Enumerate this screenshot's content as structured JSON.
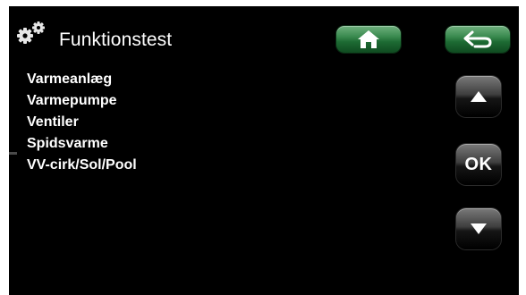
{
  "header": {
    "icon": "gears-icon",
    "title": "Funktionstest",
    "home_icon": "home-icon",
    "back_icon": "back-arrow-icon"
  },
  "menu": {
    "items": [
      {
        "label": "Varmeanlæg"
      },
      {
        "label": "Varmepumpe"
      },
      {
        "label": "Ventiler"
      },
      {
        "label": "Spidsvarme"
      },
      {
        "label": "VV-cirk/Sol/Pool"
      }
    ]
  },
  "nav": {
    "up_icon": "triangle-up-icon",
    "ok_label": "OK",
    "down_icon": "triangle-down-icon"
  },
  "colors": {
    "background": "#000000",
    "text": "#ffffff",
    "green_button": "#2f7d45",
    "dark_button": "#2a2a2a"
  }
}
